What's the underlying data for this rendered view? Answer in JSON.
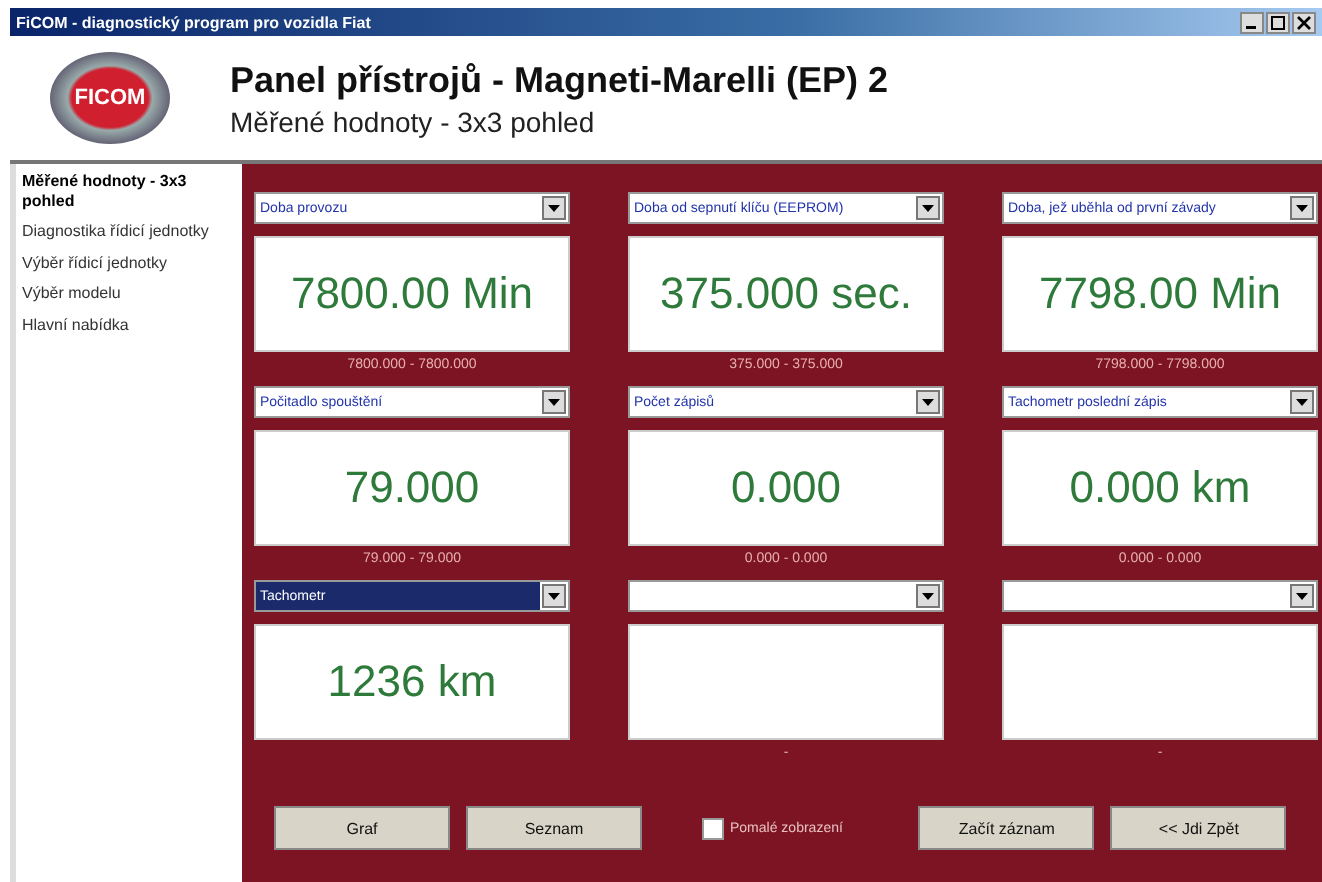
{
  "window": {
    "title": "FiCOM - diagnostický program pro vozidla Fiat"
  },
  "header": {
    "logo_text": "FICOM",
    "title": "Panel přístrojů - Magneti-Marelli (EP) 2",
    "subtitle": "Měřené hodnoty - 3x3 pohled"
  },
  "sidebar": {
    "items": [
      {
        "label": "Měřené hodnoty - 3x3 pohled",
        "selected": true
      },
      {
        "label": "Diagnostika řídicí jednotky",
        "selected": false
      },
      {
        "label": "Výběr řídicí jednotky",
        "selected": false
      },
      {
        "label": "Výběr modelu",
        "selected": false
      },
      {
        "label": "Hlavní nabídka",
        "selected": false
      }
    ]
  },
  "cells": [
    {
      "label": "Doba provozu",
      "highlighted": false,
      "value": "7800.00 Min",
      "range": "7800.000 - 7800.000"
    },
    {
      "label": "Doba od sepnutí klíču (EEPROM)",
      "highlighted": false,
      "value": "375.000 sec.",
      "range": "375.000 - 375.000"
    },
    {
      "label": "Doba, jež uběhla od první závady",
      "highlighted": false,
      "value": "7798.00 Min",
      "range": "7798.000 - 7798.000"
    },
    {
      "label": "Počitadlo spouštění",
      "highlighted": false,
      "value": "79.000",
      "range": "79.000 - 79.000"
    },
    {
      "label": "Počet zápisů",
      "highlighted": false,
      "value": "0.000",
      "range": "0.000 - 0.000"
    },
    {
      "label": "Tachometr poslední zápis",
      "highlighted": false,
      "value": "0.000 km",
      "range": "0.000 - 0.000"
    },
    {
      "label": "Tachometr",
      "highlighted": true,
      "value": "1236 km"
    },
    {
      "highlighted": false,
      "range": "-"
    },
    {
      "highlighted": false,
      "range": "-"
    }
  ],
  "footer": [
    {
      "kind": "button",
      "label": "Graf"
    },
    {
      "kind": "button",
      "label": "Seznam"
    },
    {
      "kind": "checkbox",
      "label": "Pomalé zobrazení",
      "checked": false
    },
    {
      "kind": "button",
      "label": "Začít záznam"
    },
    {
      "kind": "button",
      "label": "<< Jdi Zpět"
    }
  ]
}
